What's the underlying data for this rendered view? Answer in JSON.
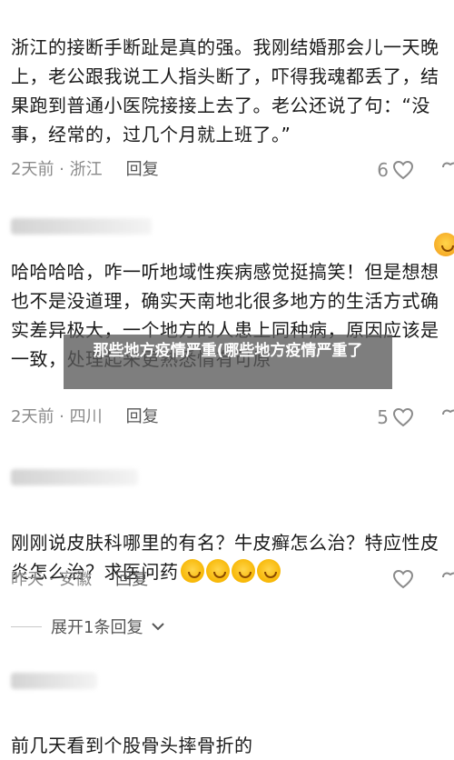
{
  "comments": [
    {
      "text": "浙江的接断手断趾是真的强。我刚结婚那会儿一天晚上，老公跟我说工人指头断了，吓得我魂都丢了，结果跑到普通小医院接接上去了。老公还说了句：“没事，经常的，过几个月就上班了。”",
      "time_location": "2天前 · 浙江",
      "reply_label": "回复",
      "likes": "6"
    },
    {
      "text": "哈哈哈哈，咋一听地域性疾病感觉挺搞笑！但是想想也不是没道理，确实天南地北很多地方的生活方式确实差异极大，一个地方的人患上同种病，原因应该是一致，处理起来更熟悉情有可原",
      "time_location": "2天前 · 四川",
      "reply_label": "回复",
      "likes": "5"
    },
    {
      "text": "刚刚说皮肤科哪里的有名？牛皮癣怎么治？特应性皮炎怎么治？求医问药",
      "time_location": "昨天 · 安徽",
      "reply_label": "回复",
      "likes": ""
    },
    {
      "text": "前几天看到个股骨头摔骨折的",
      "time_location": "",
      "reply_label": "",
      "likes": ""
    }
  ],
  "expand_replies": "展开1条回复",
  "overlay_title": "那些地方疫情严重(哪些地方疫情严重了",
  "icons": {
    "heart": "heart-icon",
    "dislike": "dislike-icon",
    "chevron": "chevron-down-icon",
    "emoji_laugh": "laughing-crying-emoji",
    "emoji_pray": "pray-emoji"
  },
  "colors": {
    "text": "#1a1a1a",
    "meta": "#8a8a8a",
    "overlay_bg": "#5a5a5a"
  }
}
